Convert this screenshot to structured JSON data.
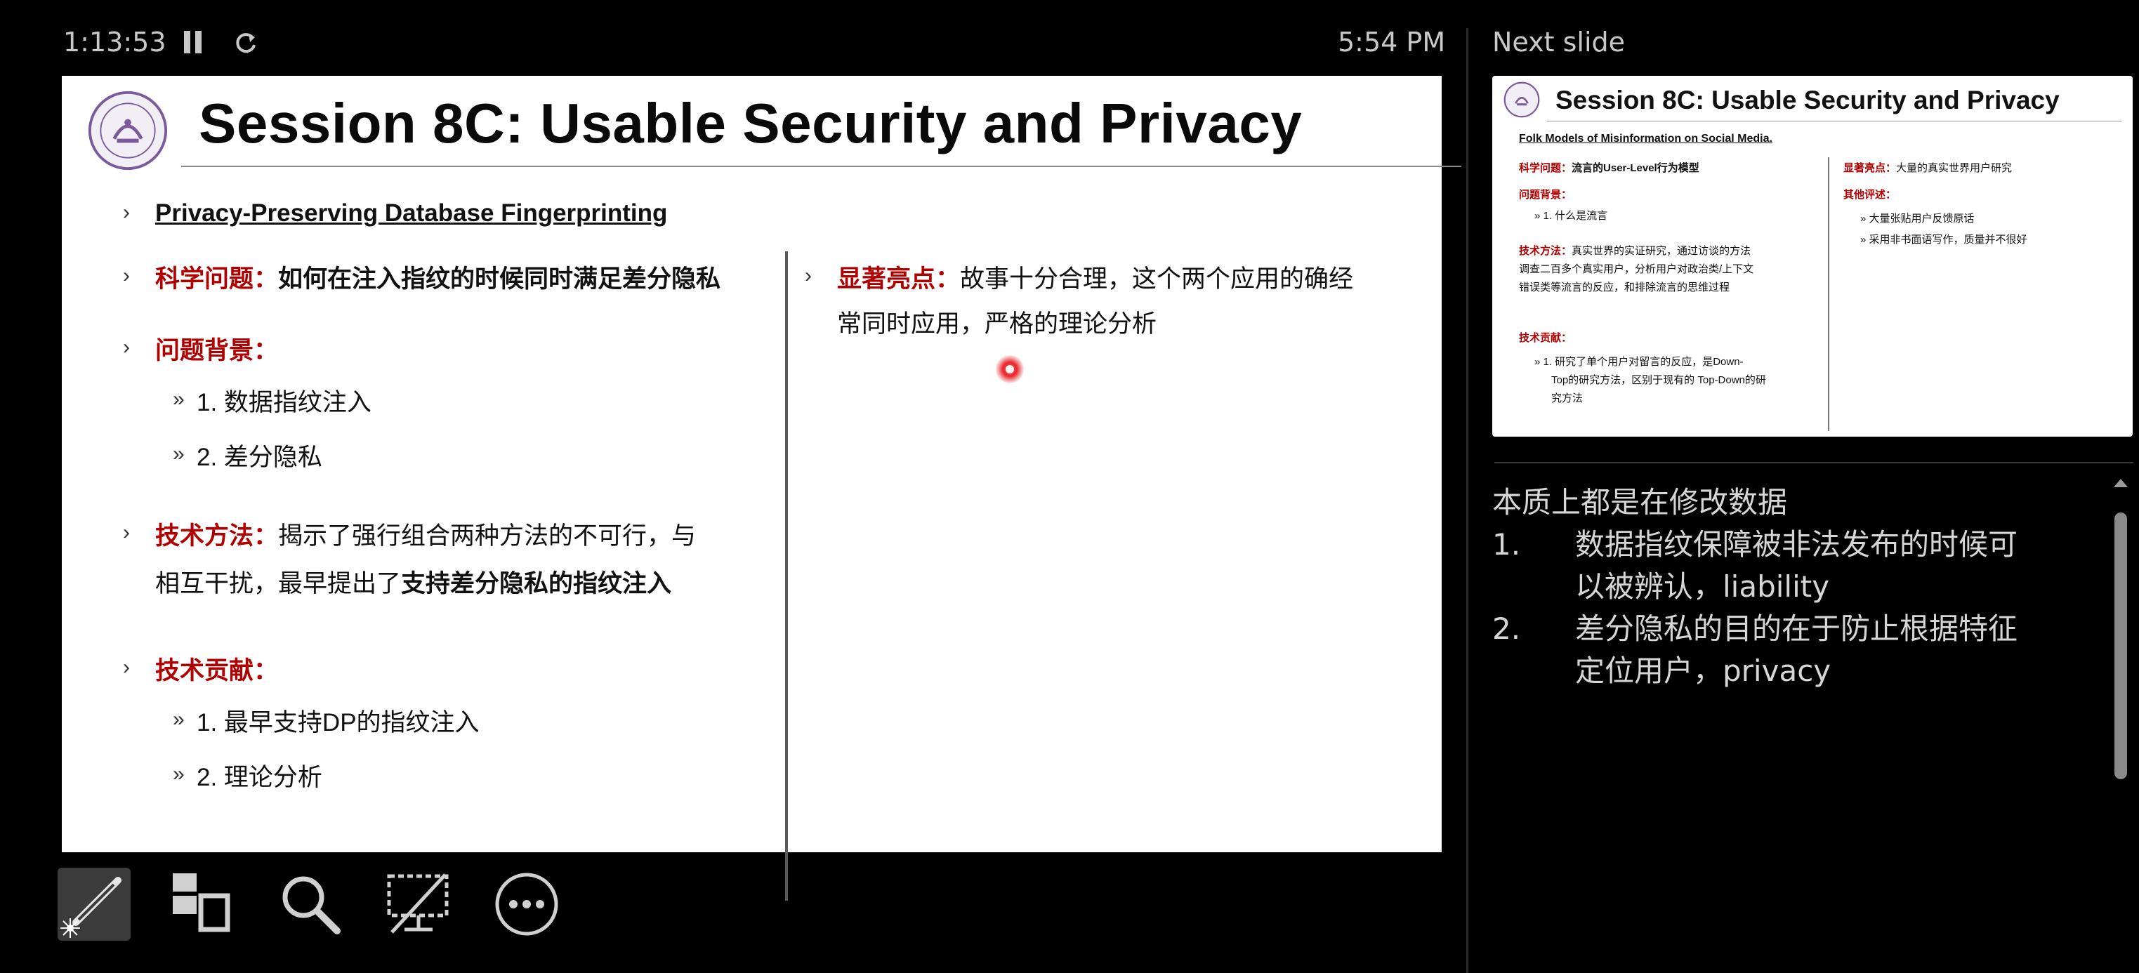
{
  "presenter": {
    "elapsed_time": "1:13:53",
    "clock": "5:54 PM",
    "next_slide_label": "Next slide"
  },
  "slide": {
    "title": "Session 8C: Usable Security and Privacy",
    "paper_title": "Privacy-Preserving Database Fingerprinting",
    "bullet_glyph": "›",
    "sub_bullet_glyph": "»",
    "left": {
      "problem_label": "科学问题：",
      "problem_text": "如何在注入指纹的时候同时满足差分隐私",
      "background_label": "问题背景：",
      "background_items": [
        "1. 数据指纹注入",
        "2. 差分隐私"
      ],
      "method_label": "技术方法：",
      "method_text_1": "揭示了强行组合两种方法的不可行，与",
      "method_text_2a": "相互干扰，最早提出了",
      "method_text_2b": "支持差分隐私的指纹注入",
      "contribution_label": "技术贡献：",
      "contribution_items": [
        "1. 最早支持DP的指纹注入",
        "2. 理论分析"
      ]
    },
    "right": {
      "highlight_label": "显著亮点：",
      "highlight_text_1": "故事十分合理，这个两个应用的确经",
      "highlight_text_2": "常同时应用，严格的理论分析"
    }
  },
  "next_slide": {
    "title": "Session 8C: Usable Security and Privacy",
    "paper_title": "Folk Models of Misinformation on Social Media.",
    "problem_label": "科学问题：",
    "problem_text": "流言的User-Level行为模型",
    "background_label": "问题背景：",
    "background_item": "» 1. 什么是流言",
    "method_label": "技术方法：",
    "method_text_1": "真实世界的实证研究，通过访谈的方法",
    "method_text_2": "调查二百多个真实用户，分析用户对政治类/上下文",
    "method_text_3": "错误类等流言的反应，和排除流言的思维过程",
    "contribution_label": "技术贡献：",
    "contribution_text_1": "» 1. 研究了单个用户对留言的反应，是Down-",
    "contribution_text_2": "Top的研究方法，区别于现有的 Top-Down的研",
    "contribution_text_3": "究方法",
    "highlight_label": "显著亮点：",
    "highlight_text": "大量的真实世界用户研究",
    "other_label": "其他评述：",
    "other_items": [
      "» 大量张贴用户反馈原话",
      "» 采用非书面语写作，质量并不很好"
    ]
  },
  "notes": {
    "heading": "本质上都是在修改数据",
    "items": [
      {
        "num": "1.",
        "line1": "数据指纹保障被非法发布的时候可",
        "line2": "以被辨认，liability"
      },
      {
        "num": "2.",
        "line1": "差分隐私的目的在于防止根据特征",
        "line2": "定位用户，privacy"
      }
    ]
  },
  "colors": {
    "label_red": "#b00000",
    "laser_pointer": "#e8262a",
    "background": "#000000"
  },
  "icons": [
    "pause-icon",
    "reset-icon",
    "pen-icon",
    "see-all-slides-icon",
    "zoom-icon",
    "black-screen-icon",
    "more-options-icon"
  ]
}
